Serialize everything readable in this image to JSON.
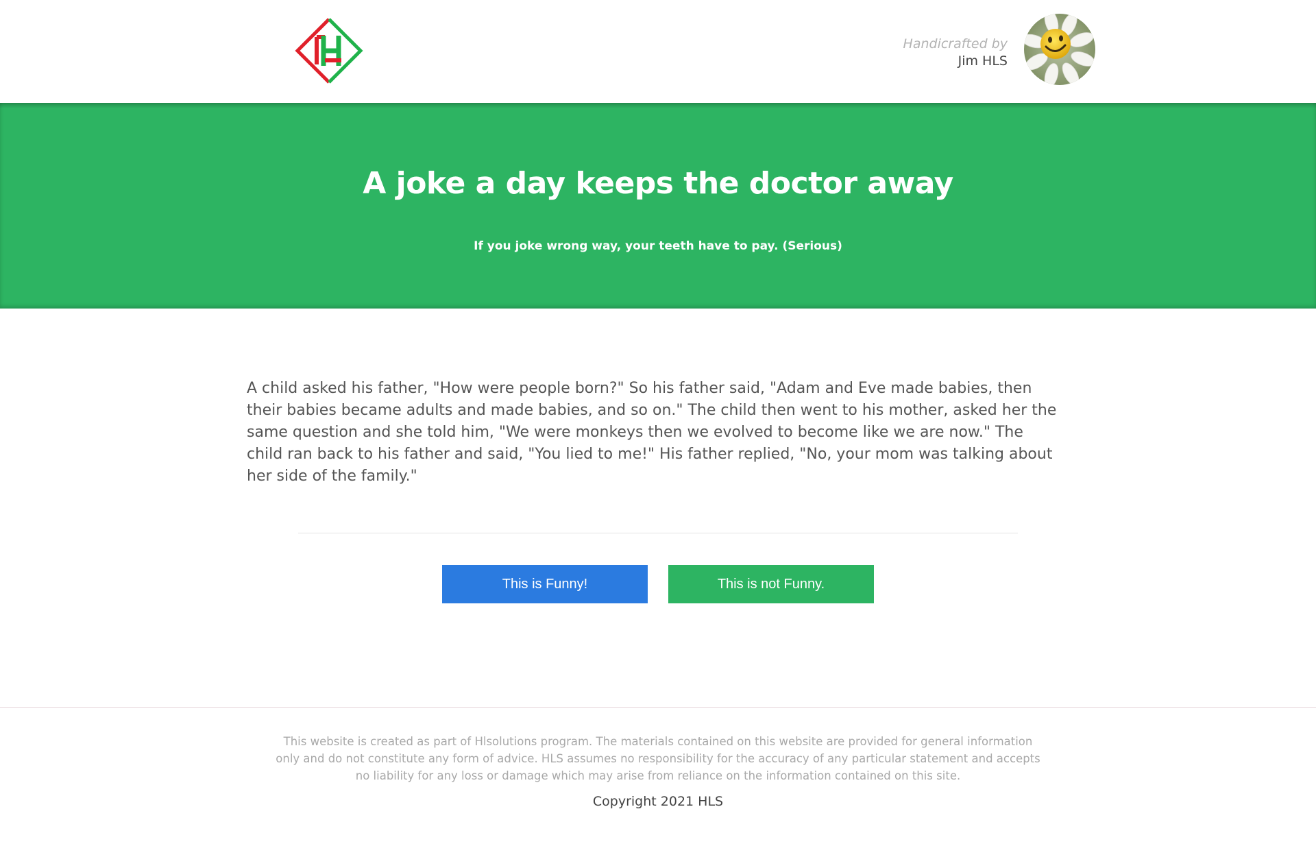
{
  "header": {
    "author_tag": "Handicrafted by",
    "author_name": "Jim HLS"
  },
  "hero": {
    "title": "A joke a day keeps the doctor away",
    "subtitle": "If you joke wrong way, your teeth have to pay. (Serious)"
  },
  "joke": {
    "text": "A child asked his father, \"How were people born?\" So his father said, \"Adam and Eve made babies, then their babies became adults and made babies, and so on.\" The child then went to his mother, asked her the same question and she told him, \"We were monkeys then we evolved to become like we are now.\" The child ran back to his father and said, \"You lied to me!\" His father replied, \"No, your mom was talking about her side of the family.\""
  },
  "actions": {
    "funny_label": "This is Funny!",
    "not_funny_label": "This is not Funny."
  },
  "footer": {
    "disclaimer": "This website is created as part of Hlsolutions program. The materials contained on this website are provided for general information only and do not constitute any form of advice. HLS assumes no responsibility for the accuracy of any particular statement and accepts no liability for any loss or damage which may arise from reliance on the information contained on this site.",
    "copyright": "Copyright 2021 HLS"
  },
  "colors": {
    "brand_green": "#2db462",
    "funny_blue": "#2b7be0",
    "logo_red": "#e0202a",
    "logo_green": "#1fb24a"
  },
  "icons": {
    "logo": "hls-diamond-logo",
    "avatar": "smiling-daisy-avatar"
  }
}
